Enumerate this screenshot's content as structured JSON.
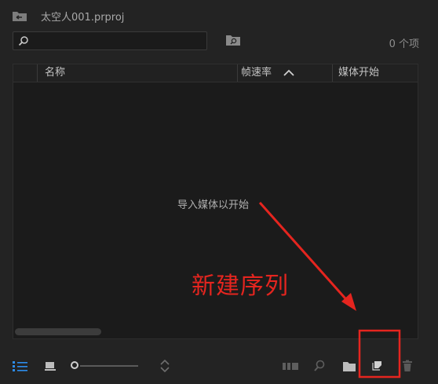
{
  "header": {
    "project_title": "太空人001.prproj"
  },
  "search": {
    "value": "",
    "placeholder": ""
  },
  "item_count": "0 个项",
  "table": {
    "columns": [
      "名称",
      "帧速率",
      "媒体开始"
    ],
    "sort_column": "帧速率",
    "sort_direction": "ascending",
    "empty_message": "导入媒体以开始"
  },
  "annotation": {
    "text": "新建序列",
    "color": "#e5251f"
  },
  "toolbar": {
    "buttons": [
      "list-view",
      "icon-view",
      "zoom-slider",
      "sort-icons",
      "automate-to-sequence",
      "find",
      "new-bin",
      "new-item",
      "clear"
    ],
    "zoom_level": 0
  },
  "colors": {
    "accent": "#2d8ceb",
    "background": "#232323",
    "panel": "#1b1b1b"
  }
}
